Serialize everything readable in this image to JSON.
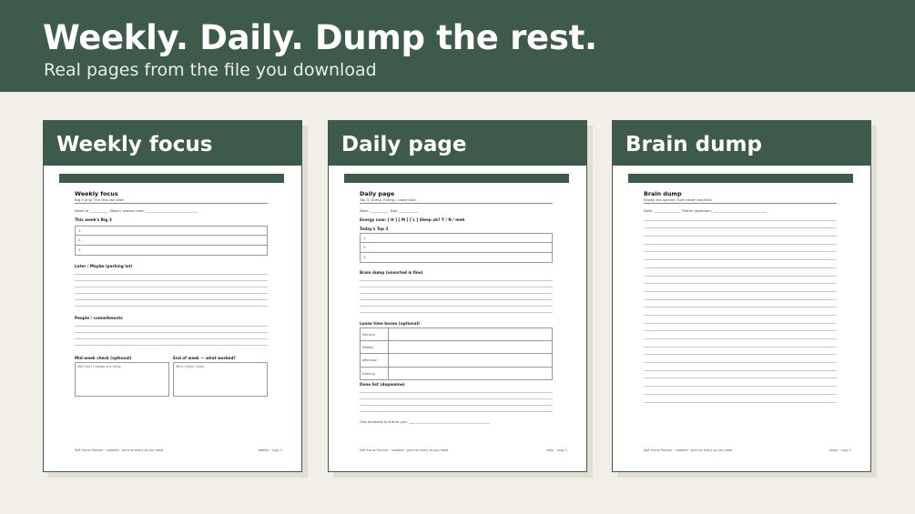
{
  "banner": {
    "title": "Weekly. Daily. Dump the rest.",
    "subtitle": "Real pages from the file you download"
  },
  "cards": {
    "weekly": {
      "heading": "Weekly focus",
      "title": "Weekly focus",
      "subtitle": "Big 3 only. The rest can wait.",
      "meta": "Week of ___________     Mood / season note: ______________________________",
      "big3_label": "This week's Big 3",
      "big3": [
        "1.",
        "2.",
        "3."
      ],
      "parking_label": "Later / Maybe (parking lot)",
      "people_label": "People / commitments",
      "midweek_label": "Mid-week check (optional)",
      "midweek_prompt": "Still true? Change one thing:",
      "endweek_label": "End of week — what worked?",
      "endweek_prompt": "Wins / keep / drop:",
      "footer_left": "Soft Focus Planner  ·  undated  ·  print as many as you need",
      "footer_right": "weekly · copy 1"
    },
    "daily": {
      "heading": "Daily page",
      "title": "Daily page",
      "subtitle": "Top 3. Dump. Energy. Loose plan.",
      "meta": "Date: ___________     Day: ___________",
      "energy": "Energy now:   [ H ]     [ M ]     [ L ]          Sleep ok?  Y / N / meh",
      "top3_label": "Today's Top 3",
      "top3": [
        "1.",
        "2.",
        "3."
      ],
      "dump_label": "Brain dump (unsorted is fine)",
      "timebox_label": "Loose time boxes (optional)",
      "timeboxes": [
        "Morning",
        "Midday",
        "Afternoon",
        "Evening"
      ],
      "done_label": "Done list (dopamine)",
      "kindness": "One kindness to future you: _______________________________________________",
      "footer_left": "Soft Focus Planner  ·  undated  ·  print as many as you need",
      "footer_right": "daily · copy 1"
    },
    "dump": {
      "heading": "Brain dump",
      "title": "Brain dump",
      "subtitle": "Empty the spinner. Sort never required.",
      "meta": "Date: _______________     Theme (optional): _______________________________",
      "footer_left": "Soft Focus Planner  ·  undated  ·  print as many as you need",
      "footer_right": "dump · copy 1"
    }
  },
  "colors": {
    "brand": "#3d5a4a",
    "background": "#f2efe8",
    "paper": "#ffffff"
  }
}
